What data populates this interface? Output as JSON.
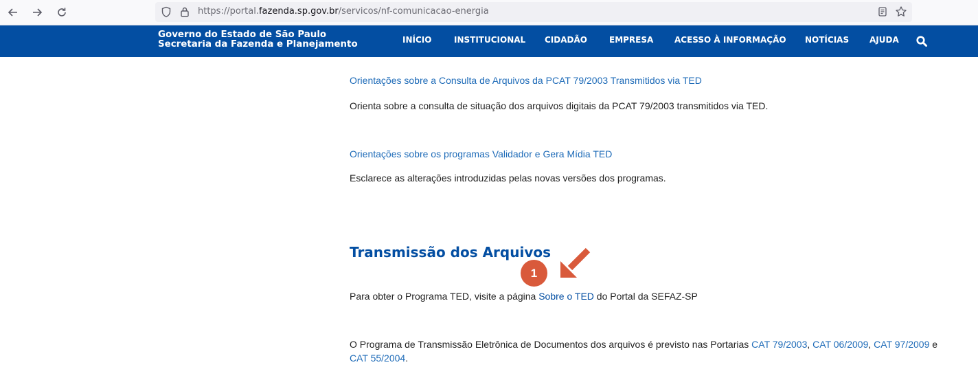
{
  "browser": {
    "url_prefix": "https://portal.",
    "url_domain": "fazenda.sp.gov.br",
    "url_path": "/servicos/nf-comunicacao-energia"
  },
  "header": {
    "brand_line1": "Governo do Estado de São Paulo",
    "brand_line2": "Secretaria da Fazenda e Planejamento",
    "nav": [
      "INÍCIO",
      "INSTITUCIONAL",
      "CIDADÃO",
      "EMPRESA",
      "ACESSO À INFORMAÇÃO",
      "NOTÍCIAS",
      "AJUDA"
    ],
    "brand_color": "#034ea2"
  },
  "items": [
    {
      "title": "Orientações sobre a Consulta de Arquivos da PCAT 79/2003 Transmitidos via TED",
      "description": "Orienta sobre a consulta de situação dos arquivos digitais da PCAT 79/2003 transmitidos via TED."
    },
    {
      "title": "Orientações sobre os programas Validador e Gera Mídia TED",
      "description": "Esclarece as alterações introduzidas pelas novas versões dos programas."
    }
  ],
  "section": {
    "title": "Transmissão dos Arquivos",
    "p1_before": "Para obter o Programa TED, visite a página ",
    "p1_link": "Sobre o TED",
    "p1_after": " do Portal da SEFAZ-SP",
    "p2_before": "O Programa de Transmissão Eletrônica de Documentos dos arquivos é previsto nas Portarias ",
    "p2_links": [
      "CAT 79/2003",
      "CAT 06/2009",
      "CAT 97/2009",
      "CAT 55/2004"
    ],
    "p2_sep1": ", ",
    "p2_sep2": ", ",
    "p2_sep3": " e",
    "p2_end": "."
  },
  "annotation": {
    "step_number": "1",
    "color": "#d95a3b"
  }
}
